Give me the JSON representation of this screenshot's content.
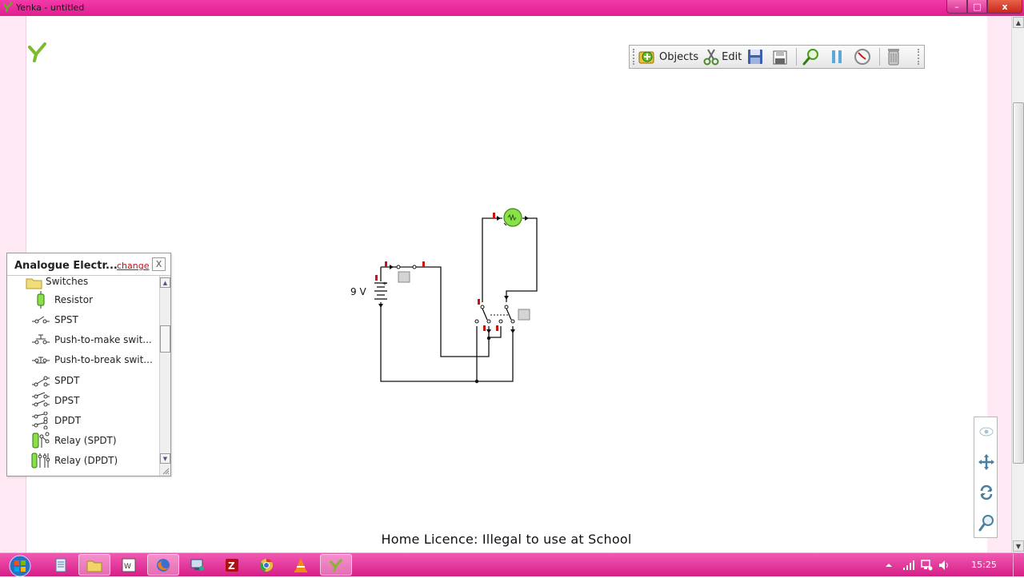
{
  "window": {
    "title": "Yenka - untitled",
    "controls": {
      "minimize": "–",
      "maximize": "□",
      "close": "x"
    }
  },
  "toolbar": {
    "objects_label": "Objects",
    "edit_label": "Edit",
    "icons": [
      "add-object-icon",
      "scissors-icon",
      "save-icon",
      "save-as-icon",
      "zoom-icon",
      "pause-icon",
      "clock-icon",
      "trash-icon"
    ]
  },
  "circuit": {
    "battery_label": "9 V"
  },
  "library": {
    "title": "Analogue Electr...",
    "change_label": "change",
    "close_label": "X",
    "folder_label": "Switches",
    "items": [
      {
        "label": "Resistor",
        "icon": "resistor-icon"
      },
      {
        "label": "SPST",
        "icon": "spst-switch-icon"
      },
      {
        "label": "Push-to-make swit...",
        "icon": "push-to-make-icon"
      },
      {
        "label": "Push-to-break swit...",
        "icon": "push-to-break-icon"
      },
      {
        "label": "SPDT",
        "icon": "spdt-switch-icon"
      },
      {
        "label": "DPST",
        "icon": "dpst-switch-icon"
      },
      {
        "label": "DPDT",
        "icon": "dpdt-switch-icon"
      },
      {
        "label": "Relay (SPDT)",
        "icon": "relay-spdt-icon"
      },
      {
        "label": "Relay (DPDT)",
        "icon": "relay-dpdt-icon"
      }
    ]
  },
  "nav": {
    "icons": [
      "eye-icon",
      "move-icon",
      "rotate-icon",
      "zoom-view-icon"
    ]
  },
  "licence_text": "Home Licence: Illegal to use at School",
  "taskbar": {
    "apps": [
      "notepad-icon",
      "explorer-icon",
      "word-icon",
      "firefox-icon",
      "network-icon",
      "filezilla-icon",
      "chrome-icon",
      "vlc-icon",
      "yenka-icon"
    ],
    "clock": "15:25"
  },
  "colors": {
    "chrome_pink": "#e01d8f",
    "wire": "#111111",
    "terminal_red": "#d01010",
    "bulb_green": "#8be04a"
  }
}
